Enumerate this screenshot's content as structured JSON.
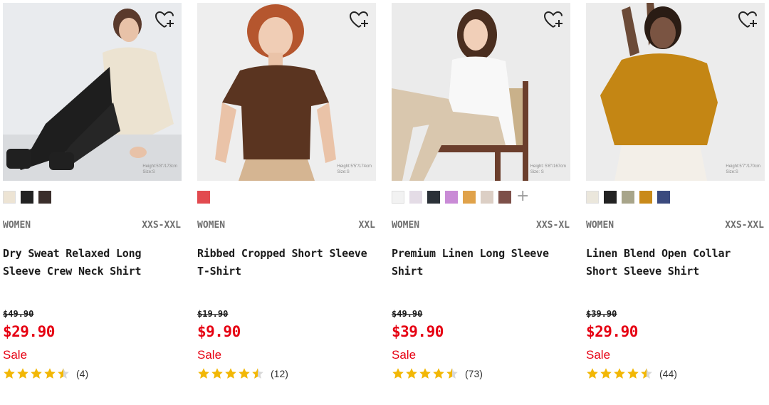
{
  "products": [
    {
      "model_info": [
        "Height:5'8\"/173cm",
        "Size:S"
      ],
      "swatches": [
        "#ede4d4",
        "#222222",
        "#3a2e2b"
      ],
      "more_colors": false,
      "gender": "WOMEN",
      "sizes": "XXS-XXL",
      "name": "Dry Sweat Relaxed Long Sleeve Crew Neck Shirt",
      "original_price": "$49.90",
      "price": "$29.90",
      "sale": "Sale",
      "rating": 4.5,
      "review_count": "(4)"
    },
    {
      "model_info": [
        "Height:5'5\"/174cm",
        "Size:S"
      ],
      "swatches": [
        "#e24a4f"
      ],
      "more_colors": false,
      "gender": "WOMEN",
      "sizes": "XXL",
      "name": "Ribbed Cropped Short Sleeve T-Shirt",
      "original_price": "$19.90",
      "price": "$9.90",
      "sale": "Sale",
      "rating": 4.5,
      "review_count": "(12)"
    },
    {
      "model_info": [
        "Height: 5'6\"/167cm",
        "Size: S"
      ],
      "swatches": [
        "#f2f2f2",
        "#e4dce6",
        "#2b3138",
        "#c98bd6",
        "#e0a24a",
        "#dccfc5",
        "#7d5049"
      ],
      "more_colors": true,
      "gender": "WOMEN",
      "sizes": "XXS-XL",
      "name": "Premium Linen Long Sleeve Shirt",
      "original_price": "$49.90",
      "price": "$39.90",
      "sale": "Sale",
      "rating": 4.5,
      "review_count": "(73)"
    },
    {
      "model_info": [
        "Height:5'7\"/170cm",
        "Size:S"
      ],
      "swatches": [
        "#ebe7dc",
        "#222222",
        "#a8a58a",
        "#c98a1a",
        "#3b4a7e"
      ],
      "more_colors": false,
      "gender": "WOMEN",
      "sizes": "XXS-XXL",
      "name": "Linen Blend Open Collar Short Sleeve Shirt",
      "original_price": "$39.90",
      "price": "$29.90",
      "sale": "Sale",
      "rating": 4.5,
      "review_count": "(44)"
    }
  ],
  "colors": {
    "sale_red": "#e60012",
    "star_gold": "#f2b705",
    "text": "#1b1b1b",
    "muted": "#707070"
  },
  "icons": {
    "wishlist": "heart-plus-icon",
    "star": "star-icon",
    "more_colors": "plus-icon"
  }
}
